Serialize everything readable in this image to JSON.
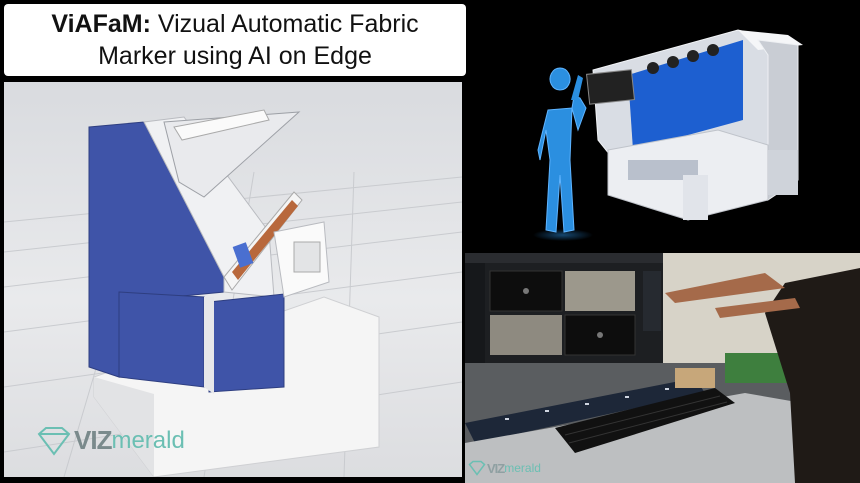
{
  "title": {
    "bold_part": "ViAFaM:",
    "line1_rest": " Vizual Automatic Fabric",
    "line2": "Marker using AI on Edge"
  },
  "logo_left": {
    "part1": "VIZ",
    "part2": "merald"
  },
  "logo_bottom": {
    "part1": "VIZ",
    "part2": "merald"
  },
  "colors": {
    "machine_blue": "#3f54a8",
    "logo_teal": "#6bbfb3",
    "silhouette": "#2b8fe0"
  }
}
